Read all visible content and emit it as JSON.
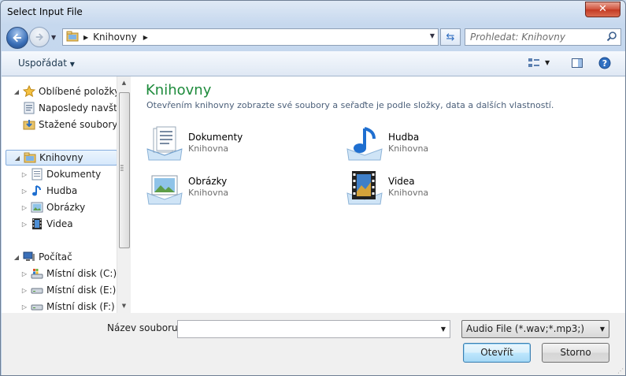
{
  "window": {
    "title": "Select Input File",
    "close_label": "✕"
  },
  "navbar": {
    "breadcrumb": [
      "Knihovny"
    ],
    "search_placeholder": "Prohledat: Knihovny"
  },
  "toolbar": {
    "organize_label": "Uspořádat"
  },
  "nav": {
    "favorites": {
      "label": "Oblíbené položky",
      "items": [
        "Naposledy navštíveno",
        "Stažené soubory"
      ]
    },
    "libraries": {
      "label": "Knihovny",
      "items": [
        "Dokumenty",
        "Hudba",
        "Obrázky",
        "Videa"
      ]
    },
    "computer": {
      "label": "Počítač",
      "items": [
        "Místní disk (C:)",
        "Místní disk (E:)",
        "Místní disk (F:)"
      ]
    }
  },
  "content": {
    "title": "Knihovny",
    "description": "Otevřením knihovny zobrazte své soubory a seřaďte je podle složky, data a dalších vlastností.",
    "libraries": [
      {
        "name": "Dokumenty",
        "type": "Knihovna",
        "icon": "documents-library-icon"
      },
      {
        "name": "Hudba",
        "type": "Knihovna",
        "icon": "music-library-icon"
      },
      {
        "name": "Obrázky",
        "type": "Knihovna",
        "icon": "pictures-library-icon"
      },
      {
        "name": "Videa",
        "type": "Knihovna",
        "icon": "videos-library-icon"
      }
    ]
  },
  "footer": {
    "filename_label": "Název souboru:",
    "filename_value": "",
    "filter_value": "Audio File (*.wav;*.mp3;)",
    "open_label": "Otevřít",
    "cancel_label": "Storno"
  }
}
